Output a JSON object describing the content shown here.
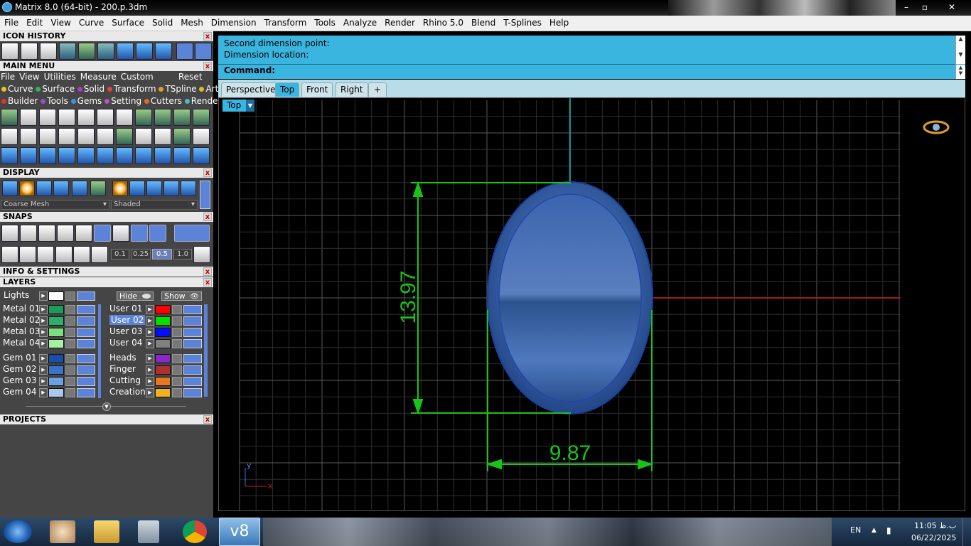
{
  "window": {
    "title": "Matrix 8.0 (64-bit) - 200.p.3dm",
    "minimize": "–",
    "maximize": "▫",
    "close": "✕"
  },
  "menubar": [
    "File",
    "Edit",
    "View",
    "Curve",
    "Surface",
    "Solid",
    "Mesh",
    "Dimension",
    "Transform",
    "Tools",
    "Analyze",
    "Render",
    "Rhino 5.0",
    "Blend",
    "T-Splines",
    "Help"
  ],
  "panels": {
    "icon_history": "ICON HISTORY",
    "main_menu": "MAIN MENU",
    "display": "DISPLAY",
    "snaps": "SNAPS",
    "info_settings": "INFO & SETTINGS",
    "layers": "LAYERS",
    "projects": "PROJECTS",
    "close_glyph": "x"
  },
  "main_menu": {
    "row1": [
      "File",
      "View",
      "Utilities",
      "Measure",
      "Custom"
    ],
    "reset": "Reset",
    "row2": [
      {
        "label": "Curve",
        "color": "#e8c020"
      },
      {
        "label": "Surface",
        "color": "#30b060"
      },
      {
        "label": "Solid",
        "color": "#a040c0"
      },
      {
        "label": "Transform",
        "color": "#e04040"
      },
      {
        "label": "TSpline",
        "color": "#e0a020"
      },
      {
        "label": "Art",
        "color": "#d0c030"
      }
    ],
    "row3": [
      {
        "label": "Builder",
        "color": "#e03030"
      },
      {
        "label": "Tools",
        "color": "#9050d0"
      },
      {
        "label": "Gems",
        "color": "#4090e0"
      },
      {
        "label": "Setting",
        "color": "#c050c0"
      },
      {
        "label": "Cutters",
        "color": "#e07020"
      },
      {
        "label": "Render",
        "color": "#40c0c0"
      }
    ]
  },
  "display": {
    "mesh_select": "Coarse Mesh",
    "shade_select": "Shaded"
  },
  "snaps": {
    "values": [
      "0.1",
      "0.25",
      "0.5",
      "1.0"
    ]
  },
  "layers": {
    "lights": "Lights",
    "hide": "Hide",
    "show": "Show",
    "left_group1": [
      {
        "name": "Metal 01",
        "color": "#1f9a5a"
      },
      {
        "name": "Metal 02",
        "color": "#2fae6a"
      },
      {
        "name": "Metal 03",
        "color": "#7be07b"
      },
      {
        "name": "Metal 04",
        "color": "#a6f0a6"
      }
    ],
    "right_group1": [
      {
        "name": "User 01",
        "color": "#ff0000"
      },
      {
        "name": "User 02",
        "color": "#00e000"
      },
      {
        "name": "User 03",
        "color": "#0010ff"
      },
      {
        "name": "User 04",
        "color": "#808080"
      }
    ],
    "left_group2": [
      {
        "name": "Gem 01",
        "color": "#1a4fa8"
      },
      {
        "name": "Gem 02",
        "color": "#3a72c8"
      },
      {
        "name": "Gem 03",
        "color": "#6d9ee0"
      },
      {
        "name": "Gem 04",
        "color": "#a8c8f0"
      }
    ],
    "right_group2": [
      {
        "name": "Heads",
        "color": "#8a28c8"
      },
      {
        "name": "Finger",
        "color": "#b03030"
      },
      {
        "name": "Cutting",
        "color": "#e87820"
      },
      {
        "name": "Creation",
        "color": "#f0b020"
      }
    ],
    "lights_color": "#ffffff"
  },
  "command": {
    "line1": "Second dimension point:",
    "line2": "Dimension location:",
    "prompt": "Command:"
  },
  "viewport_tabs": [
    "Perspective",
    "Top",
    "Front",
    "Right",
    "+"
  ],
  "active_tab": "Top",
  "viewport": {
    "label": "Top",
    "dim_vertical": "13.97",
    "dim_horizontal": "9.87",
    "axis_x": "x",
    "axis_y": "y"
  },
  "taskbar": {
    "lang": "EN",
    "time": "11:05 ب.ظ",
    "date": "06/22/2025",
    "active_app": "v8"
  }
}
